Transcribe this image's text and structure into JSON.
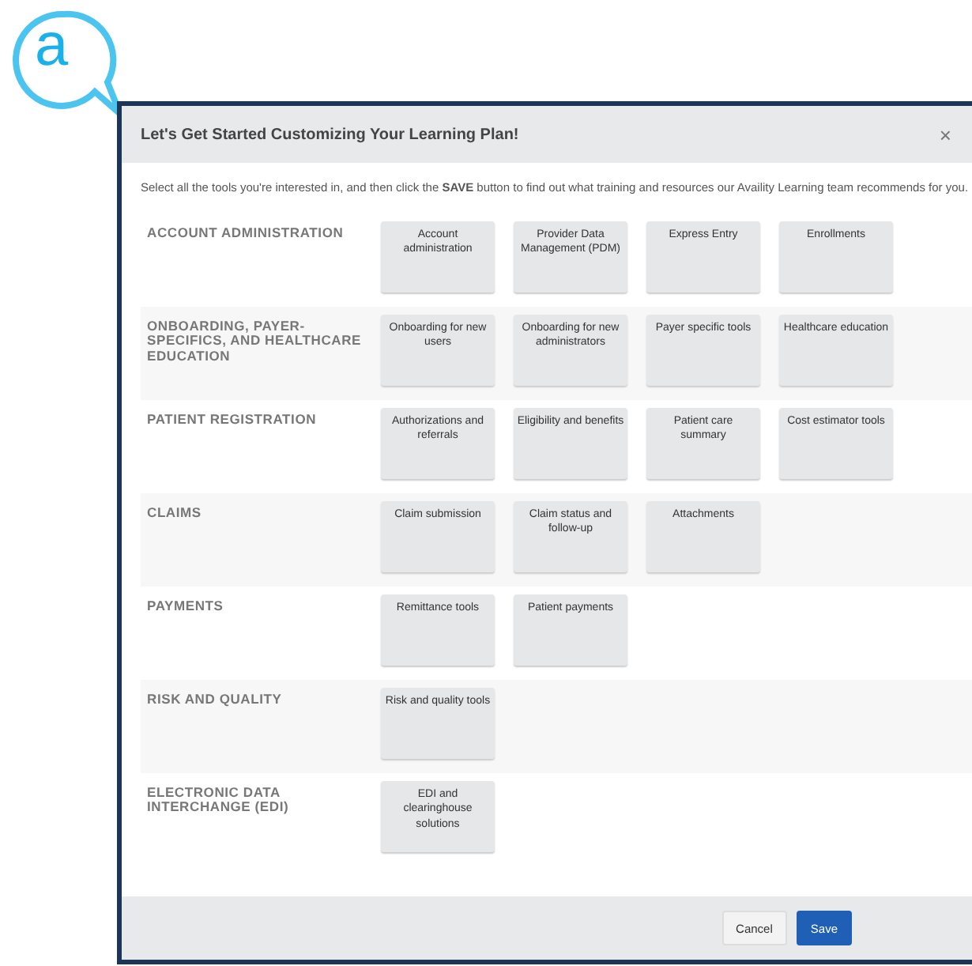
{
  "badge": {
    "letter": "a"
  },
  "dialog": {
    "title": "Let's Get Started Customizing Your Learning Plan!",
    "close": "×",
    "intro": "Select all the tools you're interested in, and then click the **SAVE** button to find out what training and resources our Availity Learning team recommends for you.",
    "categories": [
      {
        "name": "ACCOUNT ADMINISTRATION",
        "tools": [
          "Account administration",
          "Provider Data Management (PDM)",
          "Express Entry",
          "Enrollments"
        ]
      },
      {
        "name": "ONBOARDING, PAYER-SPECIFICS, AND HEALTHCARE EDUCATION",
        "tools": [
          "Onboarding for new users",
          "Onboarding for new administrators",
          "Payer specific tools",
          "Healthcare education"
        ]
      },
      {
        "name": "PATIENT REGISTRATION",
        "tools": [
          "Authorizations and referrals",
          "Eligibility and benefits",
          "Patient care summary",
          "Cost estimator tools"
        ]
      },
      {
        "name": "CLAIMS",
        "tools": [
          "Claim submission",
          "Claim status and follow-up",
          "Attachments"
        ]
      },
      {
        "name": "PAYMENTS",
        "tools": [
          "Remittance tools",
          "Patient payments"
        ]
      },
      {
        "name": "RISK AND QUALITY",
        "tools": [
          "Risk and quality tools"
        ]
      },
      {
        "name": "ELECTRONIC DATA INTERCHANGE (EDI)",
        "tools": [
          "EDI and clearinghouse solutions"
        ]
      }
    ],
    "buttons": {
      "cancel": "Cancel",
      "save": "Save"
    }
  }
}
